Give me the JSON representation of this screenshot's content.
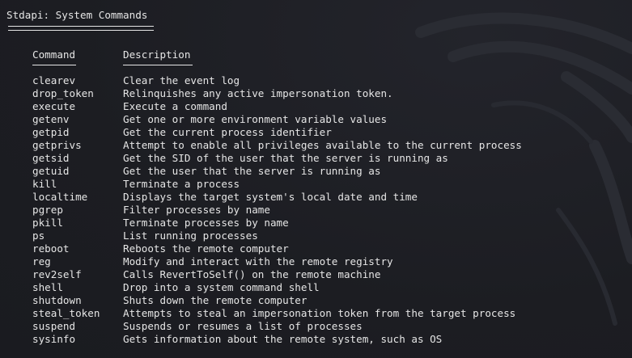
{
  "section": {
    "title": "Stdapi: System Commands"
  },
  "table": {
    "headers": {
      "command": "Command",
      "description": "Description"
    },
    "rows": [
      {
        "command": "clearev",
        "description": "Clear the event log"
      },
      {
        "command": "drop_token",
        "description": "Relinquishes any active impersonation token."
      },
      {
        "command": "execute",
        "description": "Execute a command"
      },
      {
        "command": "getenv",
        "description": "Get one or more environment variable values"
      },
      {
        "command": "getpid",
        "description": "Get the current process identifier"
      },
      {
        "command": "getprivs",
        "description": "Attempt to enable all privileges available to the current process"
      },
      {
        "command": "getsid",
        "description": "Get the SID of the user that the server is running as"
      },
      {
        "command": "getuid",
        "description": "Get the user that the server is running as"
      },
      {
        "command": "kill",
        "description": "Terminate a process"
      },
      {
        "command": "localtime",
        "description": "Displays the target system's local date and time"
      },
      {
        "command": "pgrep",
        "description": "Filter processes by name"
      },
      {
        "command": "pkill",
        "description": "Terminate processes by name"
      },
      {
        "command": "ps",
        "description": "List running processes"
      },
      {
        "command": "reboot",
        "description": "Reboots the remote computer"
      },
      {
        "command": "reg",
        "description": "Modify and interact with the remote registry"
      },
      {
        "command": "rev2self",
        "description": "Calls RevertToSelf() on the remote machine"
      },
      {
        "command": "shell",
        "description": "Drop into a system command shell"
      },
      {
        "command": "shutdown",
        "description": "Shuts down the remote computer"
      },
      {
        "command": "steal_token",
        "description": "Attempts to steal an impersonation token from the target process"
      },
      {
        "command": "suspend",
        "description": "Suspends or resumes a list of processes"
      },
      {
        "command": "sysinfo",
        "description": "Gets information about the remote system, such as OS"
      }
    ]
  },
  "colors": {
    "background": "#1c1d22",
    "text": "#e6e6e6",
    "watermark": "#2a2c33"
  },
  "icons": {
    "watermark": "kali-dragon-icon"
  }
}
